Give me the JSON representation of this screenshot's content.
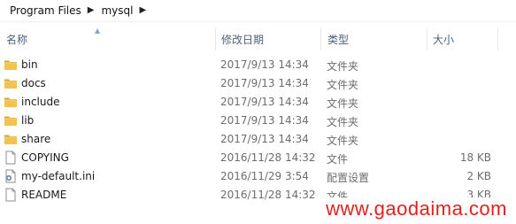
{
  "breadcrumb": [
    {
      "label": "Program Files"
    },
    {
      "label": "mysql"
    }
  ],
  "columns": {
    "name": "名称",
    "date": "修改日期",
    "type": "类型",
    "size": "大小"
  },
  "files": [
    {
      "name": "bin",
      "date": "2017/9/13 14:34",
      "type": "文件夹",
      "size": "",
      "icon": "folder-icon"
    },
    {
      "name": "docs",
      "date": "2017/9/13 14:34",
      "type": "文件夹",
      "size": "",
      "icon": "folder-icon"
    },
    {
      "name": "include",
      "date": "2017/9/13 14:34",
      "type": "文件夹",
      "size": "",
      "icon": "folder-icon"
    },
    {
      "name": "lib",
      "date": "2017/9/13 14:34",
      "type": "文件夹",
      "size": "",
      "icon": "folder-icon"
    },
    {
      "name": "share",
      "date": "2017/9/13 14:34",
      "type": "文件夹",
      "size": "",
      "icon": "folder-icon"
    },
    {
      "name": "COPYING",
      "date": "2016/11/28 14:32",
      "type": "文件",
      "size": "18 KB",
      "icon": "file-icon"
    },
    {
      "name": "my-default.ini",
      "date": "2016/11/29 3:54",
      "type": "配置设置",
      "size": "2 KB",
      "icon": "settings-file-icon"
    },
    {
      "name": "README",
      "date": "2016/11/28 14:32",
      "type": "文件",
      "size": "3 KB",
      "icon": "file-icon"
    }
  ],
  "watermark": "www.gaodaima.com"
}
